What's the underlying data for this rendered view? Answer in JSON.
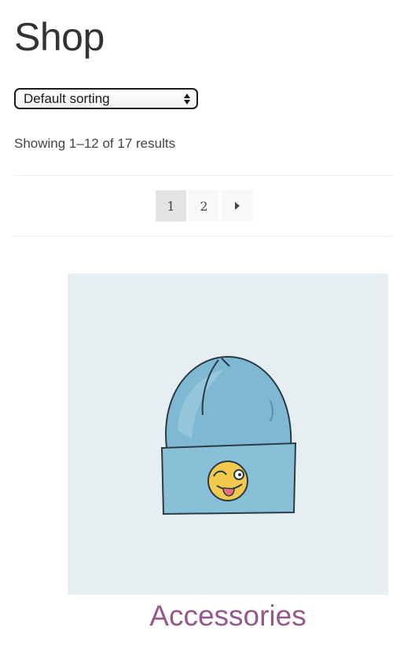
{
  "page": {
    "title": "Shop"
  },
  "sorting": {
    "selected": "Default sorting"
  },
  "results": {
    "text": "Showing 1–12 of 17 results"
  },
  "pagination": {
    "pages": [
      "1",
      "2"
    ],
    "current": "1",
    "next_icon": "triangle-right-icon"
  },
  "product": {
    "image_icon": "beanie-hat-with-winking-emoji",
    "category_label": "Accessories"
  },
  "colors": {
    "category_link": "#96588a",
    "image_background": "#e7eef2",
    "beanie": "#7fb8d2"
  }
}
